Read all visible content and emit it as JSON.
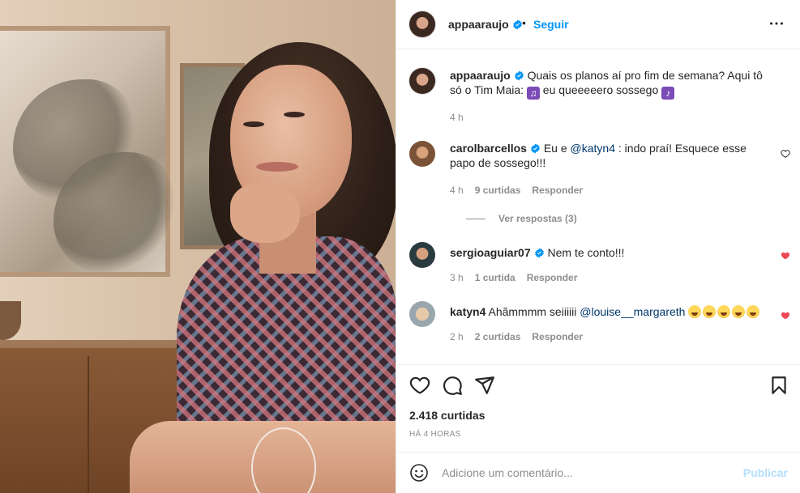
{
  "post": {
    "author": "appaaraujo",
    "follow_label": "Seguir",
    "separator": "•",
    "caption": "Quais os planos aí pro fim de semana? Aqui tô só o Tim Maia: ",
    "caption_tail": " eu queeeeero sossego ",
    "caption_time": "4 h"
  },
  "comments": [
    {
      "username": "carolbarcellos",
      "text_prefix": "Eu e ",
      "mention": "@katyn4",
      "text_suffix": " : indo praí! Esquece esse papo de sossego!!!",
      "time": "4 h",
      "likes": "9 curtidas",
      "reply": "Responder",
      "liked": false,
      "view_replies": "Ver respostas (3)"
    },
    {
      "username": "sergioaguiar07",
      "text": "Nem te conto!!!",
      "time": "3 h",
      "likes": "1 curtida",
      "reply": "Responder",
      "liked": true
    },
    {
      "username": "katyn4",
      "text_prefix": "Ahãmmmm seiiiiii ",
      "mention": "@louise__margareth",
      "emoji_count": 5,
      "time": "2 h",
      "likes": "2 curtidas",
      "reply": "Responder",
      "liked": true
    }
  ],
  "stats": {
    "likes": "2.418 curtidas",
    "posted": "HÁ 4 HORAS"
  },
  "add_comment": {
    "placeholder": "Adicione um comentário...",
    "publish": "Publicar"
  },
  "colors": {
    "link_blue": "#0095f6",
    "mention": "#00376b",
    "heart_red": "#ed4956",
    "muted": "#8e8e8e",
    "publish_disabled": "#b2dffc"
  },
  "icons": [
    "verified-icon",
    "more-icon",
    "heart-icon",
    "comment-icon",
    "share-icon",
    "bookmark-icon",
    "emoji-icon",
    "music-note-icon"
  ]
}
